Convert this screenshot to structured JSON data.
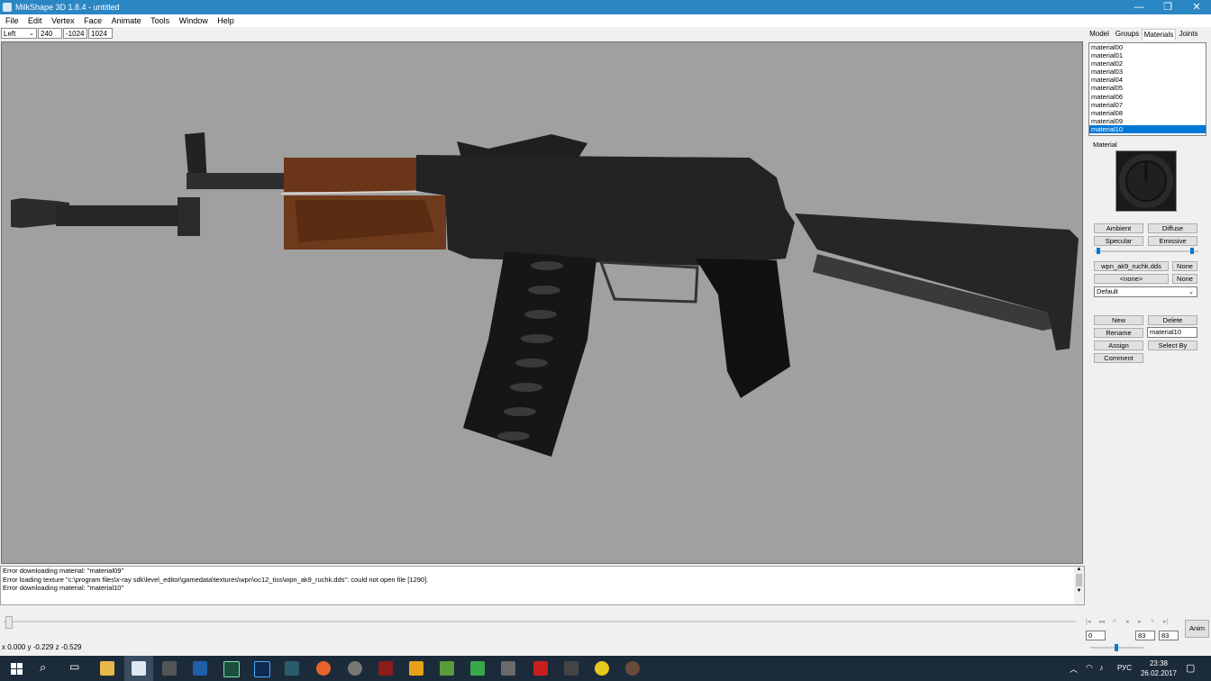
{
  "window": {
    "title": "MilkShape 3D 1.8.4 - untitled",
    "minimize": "—",
    "restore": "❐",
    "close": "✕"
  },
  "menu": [
    "File",
    "Edit",
    "Vertex",
    "Face",
    "Animate",
    "Tools",
    "Window",
    "Help"
  ],
  "toolbar": {
    "view": "Left",
    "field1": "240",
    "field2": "-1024",
    "field3": "1024"
  },
  "panel": {
    "tabs": [
      "Model",
      "Groups",
      "Materials",
      "Joints"
    ],
    "active_tab": "Materials",
    "materials": [
      "material00",
      "material01",
      "material02",
      "material03",
      "material04",
      "material05",
      "material06",
      "material07",
      "material08",
      "material09",
      "material10"
    ],
    "selected_material": "material10",
    "material_label": "Material",
    "ambient": "Ambient",
    "diffuse": "Diffuse",
    "specular": "Specular",
    "emissive": "Emissive",
    "texture1": "wpn_ak9_ruchk.dds",
    "texture2": "<none>",
    "none1": "None",
    "none2": "None",
    "mode": "Default",
    "new": "New",
    "delete": "Delete",
    "rename": "Rename",
    "rename_value": "material10",
    "assign": "Assign",
    "select_by": "Select By",
    "comment": "Comment"
  },
  "log": [
    "Error downloading material: \"material09\"",
    "Error loading texture \"c:\\program files\\x-ray sdk\\level_editor\\gamedata\\textures\\wpn\\oc12_tiss\\wpn_ak9_ruchk.dds\": could not open file [1290].",
    "Error downloading material: \"material10\""
  ],
  "timeline": {
    "frame_start": "0",
    "frame_cur": "83",
    "frame_end": "83",
    "anim": "Anim"
  },
  "status": {
    "coords": "x 0.000 y -0.229 z -0.529"
  },
  "taskbar": {
    "lang": "РУС",
    "time": "23:38",
    "date": "26.02.2017"
  },
  "colors": {
    "titlebar": "#2b87c4",
    "viewport": "#a0a0a0",
    "selection": "#0078d7",
    "taskbar": "#1c2b3a"
  }
}
